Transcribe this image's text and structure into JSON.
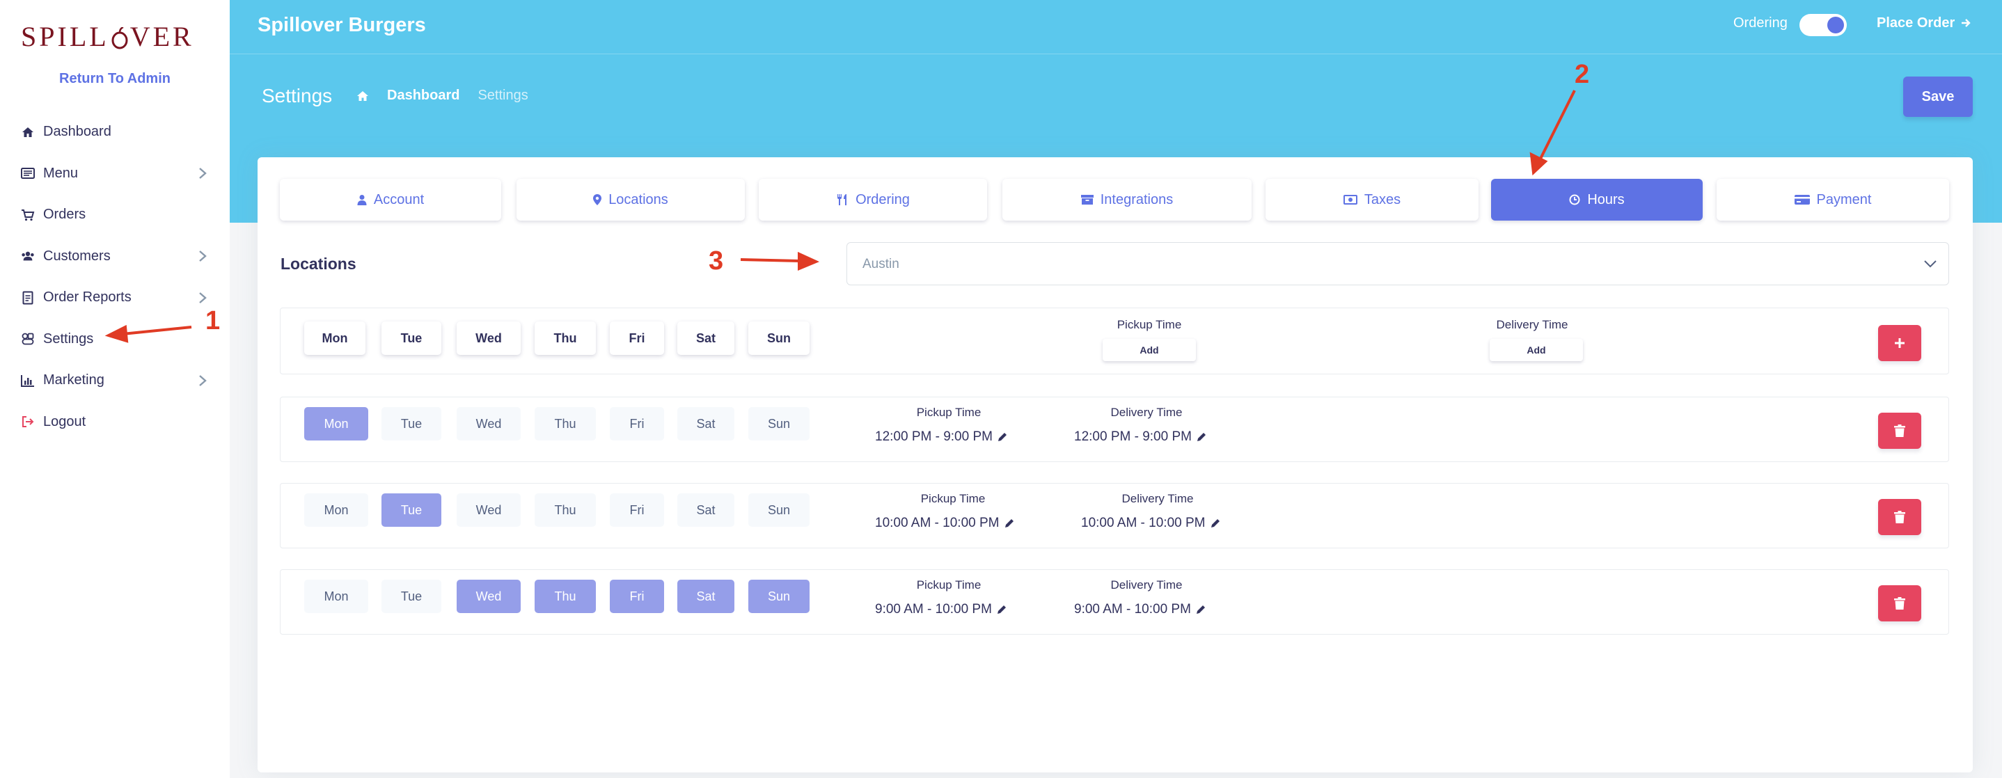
{
  "sidebar": {
    "logo_text_left": "SPILL",
    "logo_text_right": "VER",
    "return_link": "Return To Admin",
    "items": [
      {
        "label": "Dashboard",
        "icon": "home-icon",
        "has_submenu": false
      },
      {
        "label": "Menu",
        "icon": "menu-book-icon",
        "has_submenu": true
      },
      {
        "label": "Orders",
        "icon": "cart-icon",
        "has_submenu": false
      },
      {
        "label": "Customers",
        "icon": "users-icon",
        "has_submenu": true
      },
      {
        "label": "Order Reports",
        "icon": "report-icon",
        "has_submenu": true
      },
      {
        "label": "Settings",
        "icon": "settings-icon",
        "has_submenu": false
      },
      {
        "label": "Marketing",
        "icon": "bar-chart-icon",
        "has_submenu": true
      },
      {
        "label": "Logout",
        "icon": "logout-icon",
        "has_submenu": false
      }
    ]
  },
  "header": {
    "brand": "Spillover Burgers",
    "ordering_label": "Ordering",
    "ordering_enabled": true,
    "place_order": "Place Order",
    "page_title": "Settings",
    "breadcrumb": [
      "Dashboard",
      "Settings"
    ],
    "save_label": "Save"
  },
  "tabs": [
    {
      "label": "Account",
      "icon": "user-icon",
      "active": false
    },
    {
      "label": "Locations",
      "icon": "map-pin-icon",
      "active": false
    },
    {
      "label": "Ordering",
      "icon": "utensils-icon",
      "active": false
    },
    {
      "label": "Integrations",
      "icon": "archive-icon",
      "active": false
    },
    {
      "label": "Taxes",
      "icon": "money-icon",
      "active": false
    },
    {
      "label": "Hours",
      "icon": "clock-icon",
      "active": true
    },
    {
      "label": "Payment",
      "icon": "credit-card-icon",
      "active": false
    }
  ],
  "locations": {
    "label": "Locations",
    "selected": "Austin"
  },
  "days": [
    "Mon",
    "Tue",
    "Wed",
    "Thu",
    "Fri",
    "Sat",
    "Sun"
  ],
  "new_row": {
    "pickup_title": "Pickup Time",
    "delivery_title": "Delivery Time",
    "add_label": "Add"
  },
  "hours": [
    {
      "active_days": [
        "Mon"
      ],
      "pickup_title": "Pickup Time",
      "pickup": "12:00 PM - 9:00 PM",
      "delivery_title": "Delivery Time",
      "delivery": "12:00 PM - 9:00 PM"
    },
    {
      "active_days": [
        "Tue"
      ],
      "pickup_title": "Pickup Time",
      "pickup": "10:00 AM - 10:00 PM",
      "delivery_title": "Delivery Time",
      "delivery": "10:00 AM - 10:00 PM"
    },
    {
      "active_days": [
        "Wed",
        "Thu",
        "Fri",
        "Sat",
        "Sun"
      ],
      "pickup_title": "Pickup Time",
      "pickup": "9:00 AM - 10:00 PM",
      "delivery_title": "Delivery Time",
      "delivery": "9:00 AM - 10:00 PM"
    }
  ],
  "annotations": [
    "1",
    "2",
    "3"
  ],
  "colors": {
    "header": "#5bc8ed",
    "accent": "#5e72e4",
    "day_active": "#959ee9",
    "danger": "#e64560",
    "annotation": "#e03b24"
  }
}
